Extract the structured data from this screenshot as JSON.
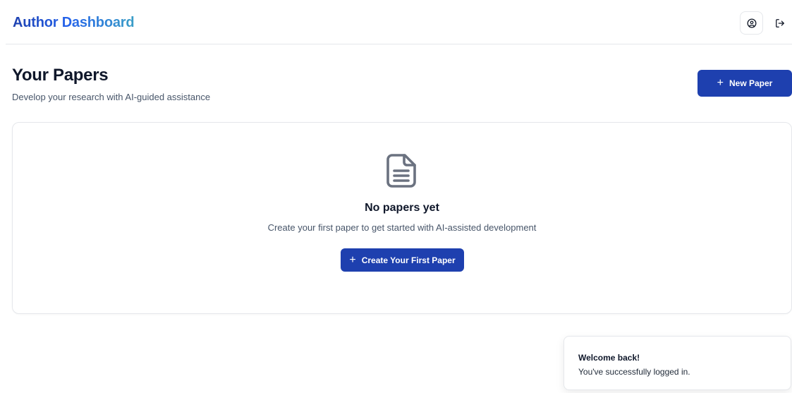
{
  "header": {
    "brand": "Author Dashboard",
    "profile_icon": "user-circle-icon",
    "logout_icon": "logout-icon"
  },
  "main": {
    "title": "Your Papers",
    "subtitle": "Develop your research with AI-guided assistance",
    "new_paper_label": "New Paper",
    "plus_glyph": "+"
  },
  "empty_state": {
    "icon": "document-icon",
    "title": "No papers yet",
    "description": "Create your first paper to get started with AI-assisted development",
    "create_label": "Create Your First Paper",
    "plus_glyph": "+"
  },
  "toast": {
    "title": "Welcome back!",
    "message": "You've successfully logged in."
  },
  "colors": {
    "primary": "#1e40af",
    "brand_gradient_start": "#1e40af",
    "brand_gradient_end": "#3b9ec7",
    "muted_text": "#475569",
    "icon_gray": "#6b7280",
    "border": "#e5e7eb"
  }
}
